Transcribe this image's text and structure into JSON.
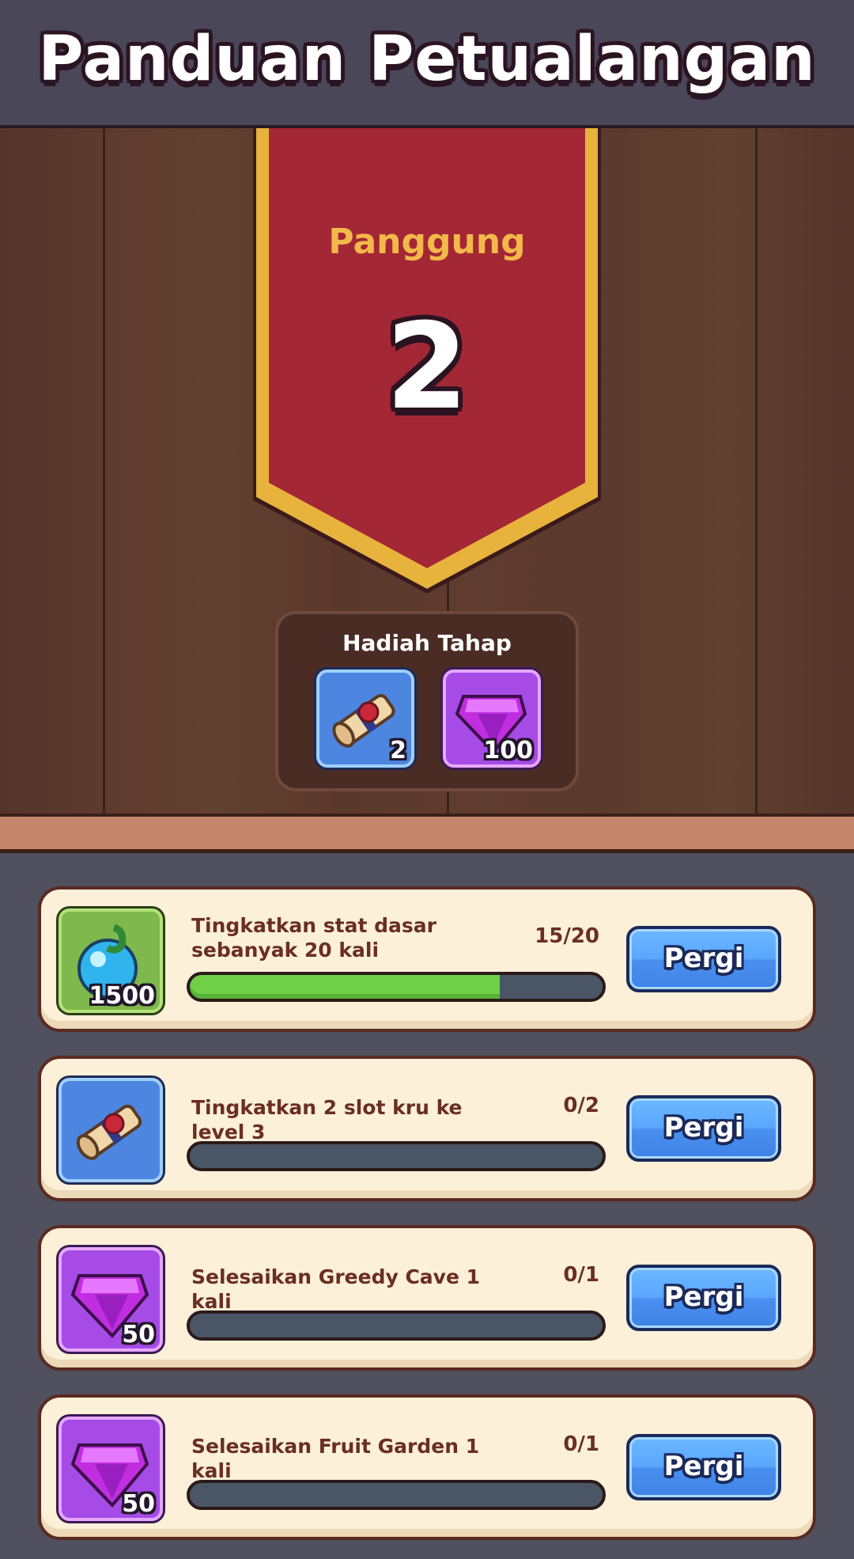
{
  "header": {
    "title": "Panduan Petualangan"
  },
  "stage": {
    "label": "Panggung",
    "number": "2"
  },
  "stage_rewards": {
    "title": "Hadiah Tahap",
    "items": [
      {
        "icon": "scroll-icon",
        "count": "2"
      },
      {
        "icon": "gem-icon",
        "count": "100"
      }
    ]
  },
  "quests": [
    {
      "icon": "potion-icon",
      "reward_count": "1500",
      "description": "Tingkatkan stat dasar sebanyak 20 kali",
      "progress_text": "15/20",
      "progress": 0.75,
      "button_label": "Pergi"
    },
    {
      "icon": "scroll-icon",
      "reward_count": "",
      "description": "Tingkatkan 2 slot kru ke level 3",
      "progress_text": "0/2",
      "progress": 0,
      "button_label": "Pergi"
    },
    {
      "icon": "gem-icon",
      "reward_count": "50",
      "description": "Selesaikan Greedy Cave 1 kali",
      "progress_text": "0/1",
      "progress": 0,
      "button_label": "Pergi"
    },
    {
      "icon": "gem-icon",
      "reward_count": "50",
      "description": "Selesaikan Fruit Garden 1 kali",
      "progress_text": "0/1",
      "progress": 0,
      "button_label": "Pergi"
    }
  ],
  "colors": {
    "banner_red": "#a42735",
    "banner_gold": "#e8b33d",
    "progress_green": "#6fd048",
    "button_blue": "#5aa6ff"
  }
}
